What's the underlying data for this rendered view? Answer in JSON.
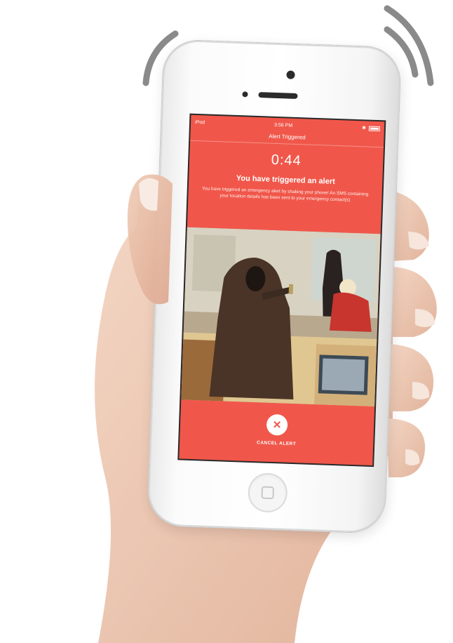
{
  "status_bar": {
    "carrier": "iPod",
    "time": "3:56 PM",
    "battery_icon": "battery-icon"
  },
  "nav": {
    "title": "Alert Triggered"
  },
  "alert": {
    "countdown": "0:44",
    "headline": "You have triggered an alert",
    "message": "You have triggered an emergency alert by shaking your phone! An SMS containing your location details has been sent to your emergency contact(s)"
  },
  "cancel": {
    "icon": "close-icon",
    "label": "CANCEL ALERT"
  },
  "colors": {
    "accent": "#f0574a",
    "text_on_accent": "#ffffff",
    "phone_body": "#f7f7f7"
  }
}
